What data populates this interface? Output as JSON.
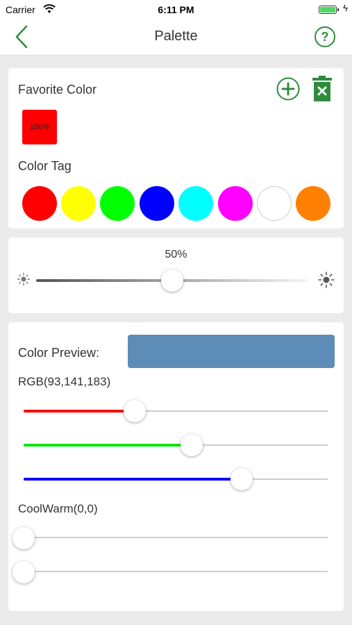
{
  "status_bar": {
    "carrier": "Carrier",
    "time": "6:11 PM",
    "battery_level": 1.0
  },
  "nav": {
    "title": "Palette",
    "help_glyph": "?"
  },
  "favorite": {
    "label": "Favorite Color",
    "swatch_text": "100%",
    "swatch_color": "#ff0000",
    "accent": "#2e8b3e"
  },
  "color_tag": {
    "label": "Color Tag",
    "colors": [
      "#ff0000",
      "#ffff00",
      "#00ff00",
      "#0000ff",
      "#00ffff",
      "#ff00ff",
      "#ffffff",
      "#ff8000"
    ]
  },
  "brightness": {
    "value_text": "50%",
    "value": 0.5
  },
  "preview": {
    "label": "Color Preview:",
    "color": "#5d8db7"
  },
  "rgb": {
    "label": "RGB(93,141,183)",
    "channels": [
      {
        "name": "red",
        "value": 93,
        "color": "#ff0000"
      },
      {
        "name": "green",
        "value": 141,
        "color": "#00e600"
      },
      {
        "name": "blue",
        "value": 183,
        "color": "#0000ff"
      }
    ]
  },
  "coolwarm": {
    "label": "CoolWarm(0,0)",
    "values": [
      0,
      0
    ]
  }
}
